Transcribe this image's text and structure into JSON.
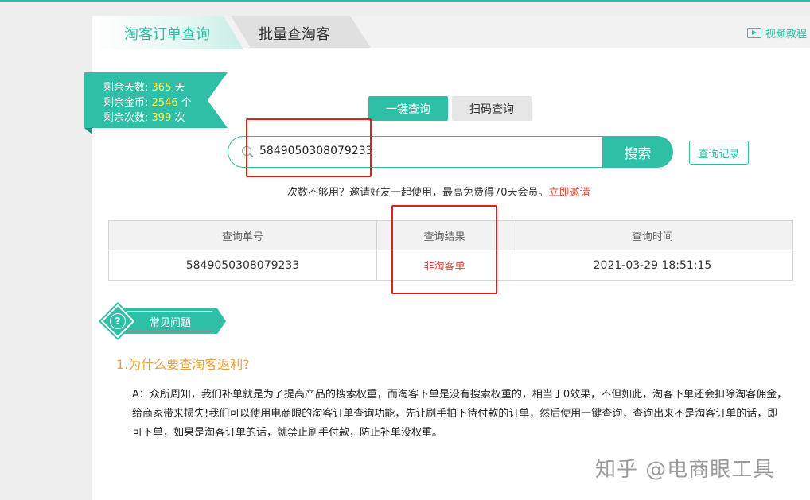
{
  "tabs": [
    {
      "label": "淘客订单查询",
      "active": true
    },
    {
      "label": "批量查淘客",
      "active": false
    }
  ],
  "video_tutorial": {
    "label": "视频教程",
    "icon": "video-icon"
  },
  "account": {
    "days_label": "剩余天数:",
    "days_value": "365",
    "days_unit": "天",
    "coins_label": "剩余金币:",
    "coins_value": "2546",
    "coins_unit": "个",
    "times_label": "剩余次数:",
    "times_value": "399",
    "times_unit": "次"
  },
  "modes": {
    "one_click": "一键查询",
    "scan": "扫码查询"
  },
  "search": {
    "value": "5849050308079233",
    "button": "搜索",
    "history": "查询记录",
    "icon": "search-icon"
  },
  "invite": {
    "text": "次数不够用？邀请好友一起使用，最高免费得70天会员。",
    "link": "立即邀请"
  },
  "result_table": {
    "headers": [
      "查询单号",
      "查询结果",
      "查询时间"
    ],
    "rows": [
      [
        "5849050308079233",
        "非淘客单",
        "2021-03-29 18:51:15"
      ]
    ]
  },
  "faq": {
    "badge": "常见问题",
    "question": "1.为什么要查淘客返利?",
    "answer": "A：众所周知，我们补单就是为了提高产品的搜索权重，而淘客下单是没有搜索权重的，相当于0效果，不但如此，淘客下单还会扣除淘客佣金，给商家带来损失!我们可以使用电商眼的淘客订单查询功能，先让刷手拍下待付款的订单，然后使用一键查询，查询出来不是淘客订单的话，即可下单，如果是淘客订单的话，就禁止刷手付款，防止补单没权重。"
  },
  "watermark": "知乎 @电商眼工具",
  "colors": {
    "accent": "#2fbfa6",
    "highlight": "#fff350",
    "alert": "#d9463e",
    "question": "#e8a03c",
    "annotation": "#e0201c"
  }
}
